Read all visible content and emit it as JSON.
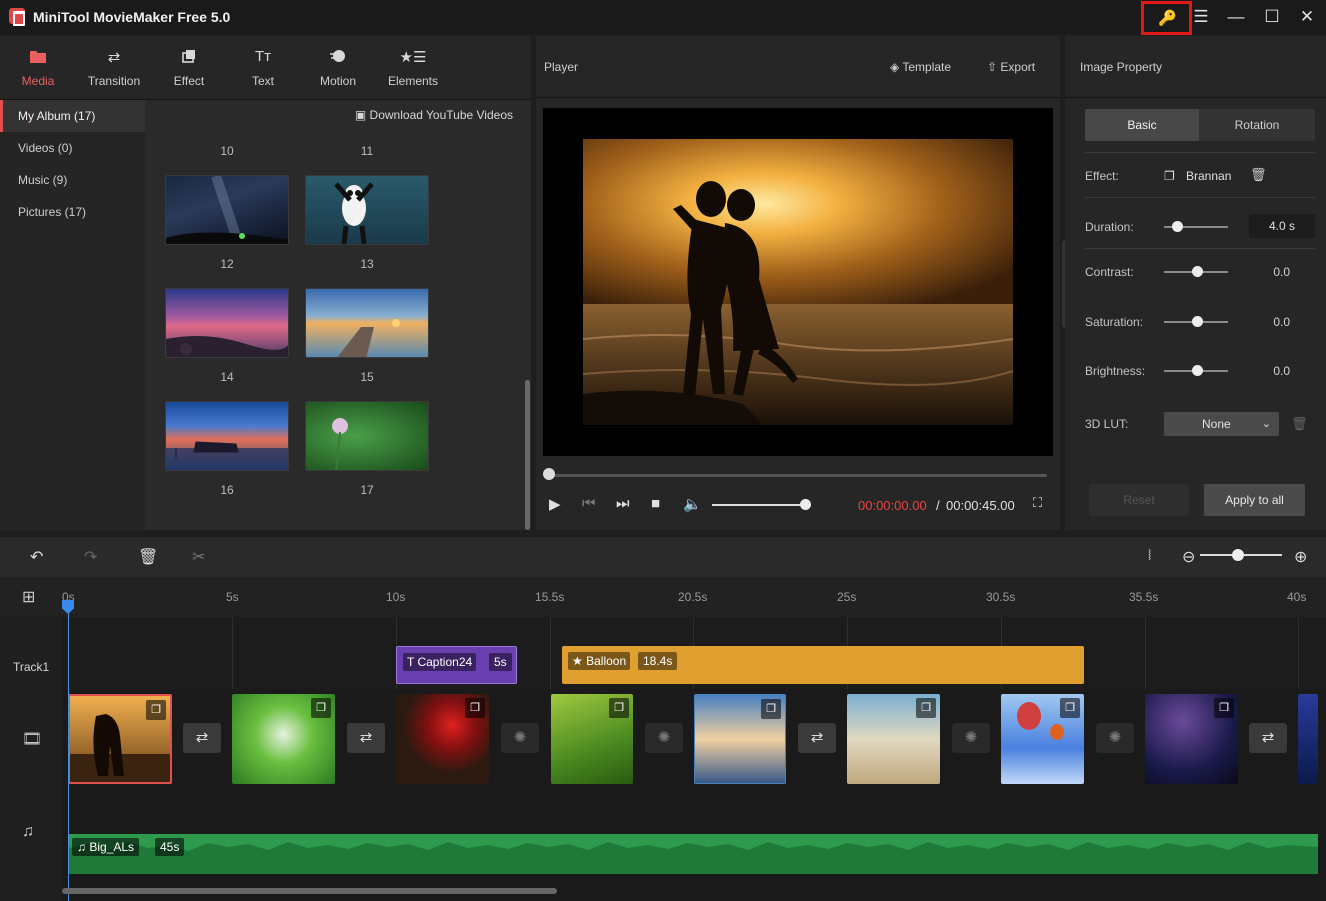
{
  "app": {
    "title": "MiniTool MovieMaker Free 5.0"
  },
  "window": {
    "min": "—",
    "max": "☐",
    "close": "✕",
    "menu": "☰",
    "key": "🔑"
  },
  "tabs": [
    {
      "label": "Media",
      "icon": "folder-icon"
    },
    {
      "label": "Transition",
      "icon": "transition-icon"
    },
    {
      "label": "Effect",
      "icon": "effect-icon"
    },
    {
      "label": "Text",
      "icon": "text-icon"
    },
    {
      "label": "Motion",
      "icon": "motion-icon"
    },
    {
      "label": "Elements",
      "icon": "elements-icon"
    }
  ],
  "sidebar": {
    "items": [
      {
        "label": "My Album (17)"
      },
      {
        "label": "Videos (0)"
      },
      {
        "label": "Music (9)"
      },
      {
        "label": "Pictures (17)"
      }
    ]
  },
  "media": {
    "download_label": "Download YouTube Videos",
    "numbers": [
      "10",
      "11",
      "12",
      "13",
      "14",
      "15",
      "16",
      "17"
    ]
  },
  "player": {
    "title": "Player",
    "template_label": "Template",
    "export_label": "Export",
    "time_current": "00:00:00.00",
    "time_sep": "/",
    "time_total": "00:00:45.00"
  },
  "props": {
    "title": "Image Property",
    "tab_basic": "Basic",
    "tab_rotation": "Rotation",
    "effect_label": "Effect:",
    "effect_value": "Brannan",
    "duration_label": "Duration:",
    "duration_value": "4.0 s",
    "contrast_label": "Contrast:",
    "contrast_value": "0.0",
    "saturation_label": "Saturation:",
    "saturation_value": "0.0",
    "brightness_label": "Brightness:",
    "brightness_value": "0.0",
    "lut_label": "3D LUT:",
    "lut_value": "None",
    "reset_label": "Reset",
    "apply_label": "Apply to all"
  },
  "timeline": {
    "ticks": [
      "0s",
      "5s",
      "10s",
      "15.5s",
      "20.5s",
      "25s",
      "30.5s",
      "35.5s",
      "40s"
    ],
    "track1_label": "Track1",
    "caption": {
      "label": "Caption24",
      "length": "5s"
    },
    "balloon": {
      "label": "Balloon",
      "length": "18.4s"
    },
    "audio": {
      "label": "Big_ALs",
      "length": "45s"
    }
  },
  "colors": {
    "accent": "#e96060",
    "caption": "#6a3fb0",
    "balloon": "#e0a030",
    "audio": "#2d9a4e",
    "timecode": "#e64545"
  }
}
